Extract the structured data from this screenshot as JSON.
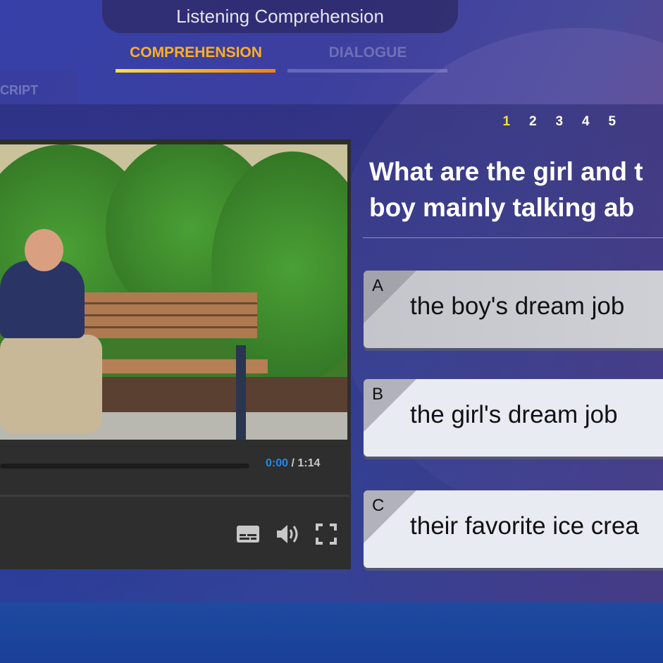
{
  "header": {
    "title": "Listening Comprehension"
  },
  "tabs": [
    {
      "label": "COMPREHENSION",
      "active": true
    },
    {
      "label": "DIALOGUE",
      "active": false
    }
  ],
  "side_tab": {
    "label": "CRIPT"
  },
  "question_numbers": [
    {
      "label": "1",
      "active": true
    },
    {
      "label": "2"
    },
    {
      "label": "3"
    },
    {
      "label": "4"
    },
    {
      "label": "5"
    }
  ],
  "video": {
    "current_time": "0:00",
    "separator": " / ",
    "duration": "1:14",
    "progress": 0,
    "controls": [
      "subtitles-icon",
      "volume-icon",
      "fullscreen-icon"
    ]
  },
  "question": {
    "line1": "What are the girl and t",
    "line2": "boy mainly talking ab"
  },
  "options": [
    {
      "letter": "A",
      "text": "the boy's dream job",
      "selected": true
    },
    {
      "letter": "B",
      "text": "the girl's dream job",
      "selected": false
    },
    {
      "letter": "C",
      "text": "their favorite ice crea",
      "selected": false
    }
  ],
  "colors": {
    "active_tab": "#ffb020",
    "active_number": "#f0e040",
    "time_current": "#1a8cf0"
  }
}
